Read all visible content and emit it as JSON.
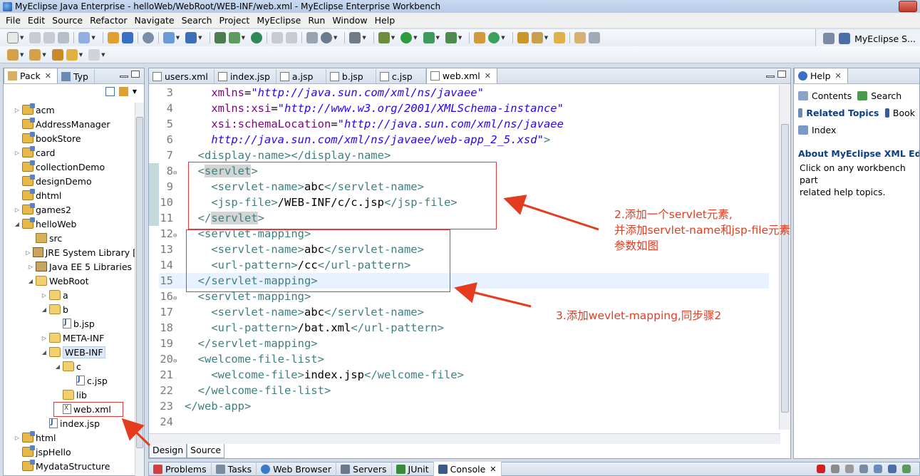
{
  "window": {
    "title": "MyEclipse Java Enterprise - helloWeb/WebRoot/WEB-INF/web.xml - MyEclipse Enterprise Workbench"
  },
  "menu": [
    "File",
    "Edit",
    "Source",
    "Refactor",
    "Navigate",
    "Search",
    "Project",
    "MyEclipse",
    "Run",
    "Window",
    "Help"
  ],
  "perspective": {
    "label": "MyEclipse S..."
  },
  "package_explorer": {
    "tabs": [
      {
        "label": "Pack",
        "active": true
      },
      {
        "label": "Typ",
        "active": false
      }
    ],
    "tree": [
      {
        "label": "acm",
        "depth": 0,
        "twisty": "▷",
        "icon": "proj"
      },
      {
        "label": "AddressManager",
        "depth": 0,
        "twisty": "",
        "icon": "proj"
      },
      {
        "label": "bookStore",
        "depth": 0,
        "twisty": "",
        "icon": "proj"
      },
      {
        "label": "card",
        "depth": 0,
        "twisty": "▷",
        "icon": "proj"
      },
      {
        "label": "collectionDemo",
        "depth": 0,
        "twisty": "",
        "icon": "proj"
      },
      {
        "label": "designDemo",
        "depth": 0,
        "twisty": "",
        "icon": "proj"
      },
      {
        "label": "dhtml",
        "depth": 0,
        "twisty": "",
        "icon": "proj"
      },
      {
        "label": "games2",
        "depth": 0,
        "twisty": "▷",
        "icon": "proj"
      },
      {
        "label": "helloWeb",
        "depth": 0,
        "twisty": "◢",
        "icon": "proj"
      },
      {
        "label": "src",
        "depth": 1,
        "twisty": "",
        "icon": "src"
      },
      {
        "label": "JRE System Library [",
        "depth": 1,
        "twisty": "▷",
        "icon": "lib"
      },
      {
        "label": "Java EE 5 Libraries",
        "depth": 1,
        "twisty": "▷",
        "icon": "lib"
      },
      {
        "label": "WebRoot",
        "depth": 1,
        "twisty": "◢",
        "icon": "folder"
      },
      {
        "label": "a",
        "depth": 2,
        "twisty": "▷",
        "icon": "folder"
      },
      {
        "label": "b",
        "depth": 2,
        "twisty": "◢",
        "icon": "folder"
      },
      {
        "label": "b.jsp",
        "depth": 3,
        "twisty": "",
        "icon": "jsp"
      },
      {
        "label": "META-INF",
        "depth": 2,
        "twisty": "▷",
        "icon": "folder"
      },
      {
        "label": "WEB-INF",
        "depth": 2,
        "twisty": "◢",
        "icon": "folder",
        "selected": true
      },
      {
        "label": "c",
        "depth": 3,
        "twisty": "◢",
        "icon": "folder"
      },
      {
        "label": "c.jsp",
        "depth": 4,
        "twisty": "",
        "icon": "jsp"
      },
      {
        "label": "lib",
        "depth": 3,
        "twisty": "",
        "icon": "folder"
      },
      {
        "label": "web.xml",
        "depth": 3,
        "twisty": "",
        "icon": "xml"
      },
      {
        "label": "index.jsp",
        "depth": 2,
        "twisty": "",
        "icon": "jsp"
      },
      {
        "label": "html",
        "depth": 0,
        "twisty": "▷",
        "icon": "proj"
      },
      {
        "label": "jspHello",
        "depth": 0,
        "twisty": "",
        "icon": "proj"
      },
      {
        "label": "MydataStructure",
        "depth": 0,
        "twisty": "",
        "icon": "proj"
      }
    ]
  },
  "editor": {
    "tabs": [
      {
        "label": "users.xml",
        "active": false
      },
      {
        "label": "index.jsp",
        "active": false
      },
      {
        "label": "a.jsp",
        "active": false
      },
      {
        "label": "b.jsp",
        "active": false
      },
      {
        "label": "c.jsp",
        "active": false
      },
      {
        "label": "web.xml",
        "active": true
      }
    ],
    "lines": [
      {
        "n": "3",
        "fold": "",
        "indent": "    ",
        "parts": [
          [
            "attr",
            "xmlns"
          ],
          [
            "txt",
            "="
          ],
          [
            "val",
            "\"http://java.sun.com/xml/ns/javaee\""
          ]
        ]
      },
      {
        "n": "4",
        "fold": "",
        "indent": "    ",
        "parts": [
          [
            "attr",
            "xmlns:xsi"
          ],
          [
            "txt",
            "="
          ],
          [
            "val",
            "\"http://www.w3.org/2001/XMLSchema-instance\""
          ]
        ]
      },
      {
        "n": "5",
        "fold": "",
        "indent": "    ",
        "parts": [
          [
            "attr",
            "xsi:schemaLocation"
          ],
          [
            "txt",
            "="
          ],
          [
            "val",
            "\"http://java.sun.com/xml/ns/javaee"
          ]
        ]
      },
      {
        "n": "6",
        "fold": "",
        "indent": "    ",
        "parts": [
          [
            "val",
            "http://java.sun.com/xml/ns/javaee/web-app_2_5.xsd\""
          ],
          [
            "tag",
            ">"
          ]
        ]
      },
      {
        "n": "7",
        "fold": "",
        "indent": "  ",
        "parts": [
          [
            "tag",
            "<display-name></display-name>"
          ]
        ]
      },
      {
        "n": "8",
        "fold": "⊖",
        "indent": "  ",
        "parts": [
          [
            "tag",
            "<"
          ],
          [
            "hl",
            "servlet"
          ],
          [
            "tag",
            ">"
          ]
        ]
      },
      {
        "n": "9",
        "fold": "",
        "indent": "    ",
        "parts": [
          [
            "tag",
            "<servlet-name>"
          ],
          [
            "txt",
            "abc"
          ],
          [
            "tag",
            "</servlet-name>"
          ]
        ]
      },
      {
        "n": "10",
        "fold": "",
        "indent": "    ",
        "parts": [
          [
            "tag",
            "<jsp-file>"
          ],
          [
            "txt",
            "/WEB-INF/c/c.jsp"
          ],
          [
            "tag",
            "</jsp-file>"
          ]
        ]
      },
      {
        "n": "11",
        "fold": "",
        "indent": "  ",
        "parts": [
          [
            "tag",
            "</"
          ],
          [
            "hl",
            "servlet"
          ],
          [
            "tag",
            ">"
          ]
        ]
      },
      {
        "n": "12",
        "fold": "⊖",
        "indent": "  ",
        "parts": [
          [
            "tag",
            "<servlet-mapping>"
          ]
        ]
      },
      {
        "n": "13",
        "fold": "",
        "indent": "    ",
        "parts": [
          [
            "tag",
            "<servlet-name>"
          ],
          [
            "txt",
            "abc"
          ],
          [
            "tag",
            "</servlet-name>"
          ]
        ]
      },
      {
        "n": "14",
        "fold": "",
        "indent": "    ",
        "parts": [
          [
            "tag",
            "<url-pattern>"
          ],
          [
            "txt",
            "/cc"
          ],
          [
            "tag",
            "</url-pattern>"
          ]
        ]
      },
      {
        "n": "15",
        "fold": "",
        "indent": "  ",
        "parts": [
          [
            "tag",
            "</servlet-mapping>"
          ]
        ],
        "current": true
      },
      {
        "n": "16",
        "fold": "⊖",
        "indent": "  ",
        "parts": [
          [
            "tag",
            "<servlet-mapping>"
          ]
        ]
      },
      {
        "n": "17",
        "fold": "",
        "indent": "    ",
        "parts": [
          [
            "tag",
            "<servlet-name>"
          ],
          [
            "txt",
            "abc"
          ],
          [
            "tag",
            "</servlet-name>"
          ]
        ]
      },
      {
        "n": "18",
        "fold": "",
        "indent": "    ",
        "parts": [
          [
            "tag",
            "<url-pattern>"
          ],
          [
            "txt",
            "/bat.xml"
          ],
          [
            "tag",
            "</url-pattern>"
          ]
        ]
      },
      {
        "n": "19",
        "fold": "",
        "indent": "  ",
        "parts": [
          [
            "tag",
            "</servlet-mapping>"
          ]
        ]
      },
      {
        "n": "20",
        "fold": "⊖",
        "indent": "  ",
        "parts": [
          [
            "tag",
            "<welcome-file-list>"
          ]
        ]
      },
      {
        "n": "21",
        "fold": "",
        "indent": "    ",
        "parts": [
          [
            "tag",
            "<welcome-file>"
          ],
          [
            "txt",
            "index.jsp"
          ],
          [
            "tag",
            "</welcome-file>"
          ]
        ]
      },
      {
        "n": "22",
        "fold": "",
        "indent": "  ",
        "parts": [
          [
            "tag",
            "</welcome-file-list>"
          ]
        ]
      },
      {
        "n": "23",
        "fold": "",
        "indent": "",
        "parts": [
          [
            "tag",
            "</web-app>"
          ]
        ]
      },
      {
        "n": "24",
        "fold": "",
        "indent": "",
        "parts": []
      }
    ],
    "bottom_tabs": [
      {
        "label": "Design",
        "active": false
      },
      {
        "label": "Source",
        "active": true
      }
    ]
  },
  "help": {
    "tab": "Help",
    "links": {
      "contents": "Contents",
      "search": "Search",
      "related": "Related Topics",
      "book": "Book",
      "index": "Index"
    },
    "section_title": "About MyEclipse XML Edito",
    "description": "Click on any workbench part",
    "description2": "related help topics."
  },
  "bottom_views": [
    "Problems",
    "Tasks",
    "Web Browser",
    "Servers",
    "JUnit",
    "Console"
  ],
  "annotations": {
    "note2_line1": "2.添加一个servlet元素,",
    "note2_line2": "并添加servlet-name和jsp-file元素",
    "note2_line3": "参数如图",
    "note3": "3.添加wevlet-mapping,同步骤2"
  },
  "colors": {
    "tag": "#3f7f7f",
    "attr": "#7f007f",
    "value": "#2a00ff",
    "annotation": "#e53b1f"
  }
}
